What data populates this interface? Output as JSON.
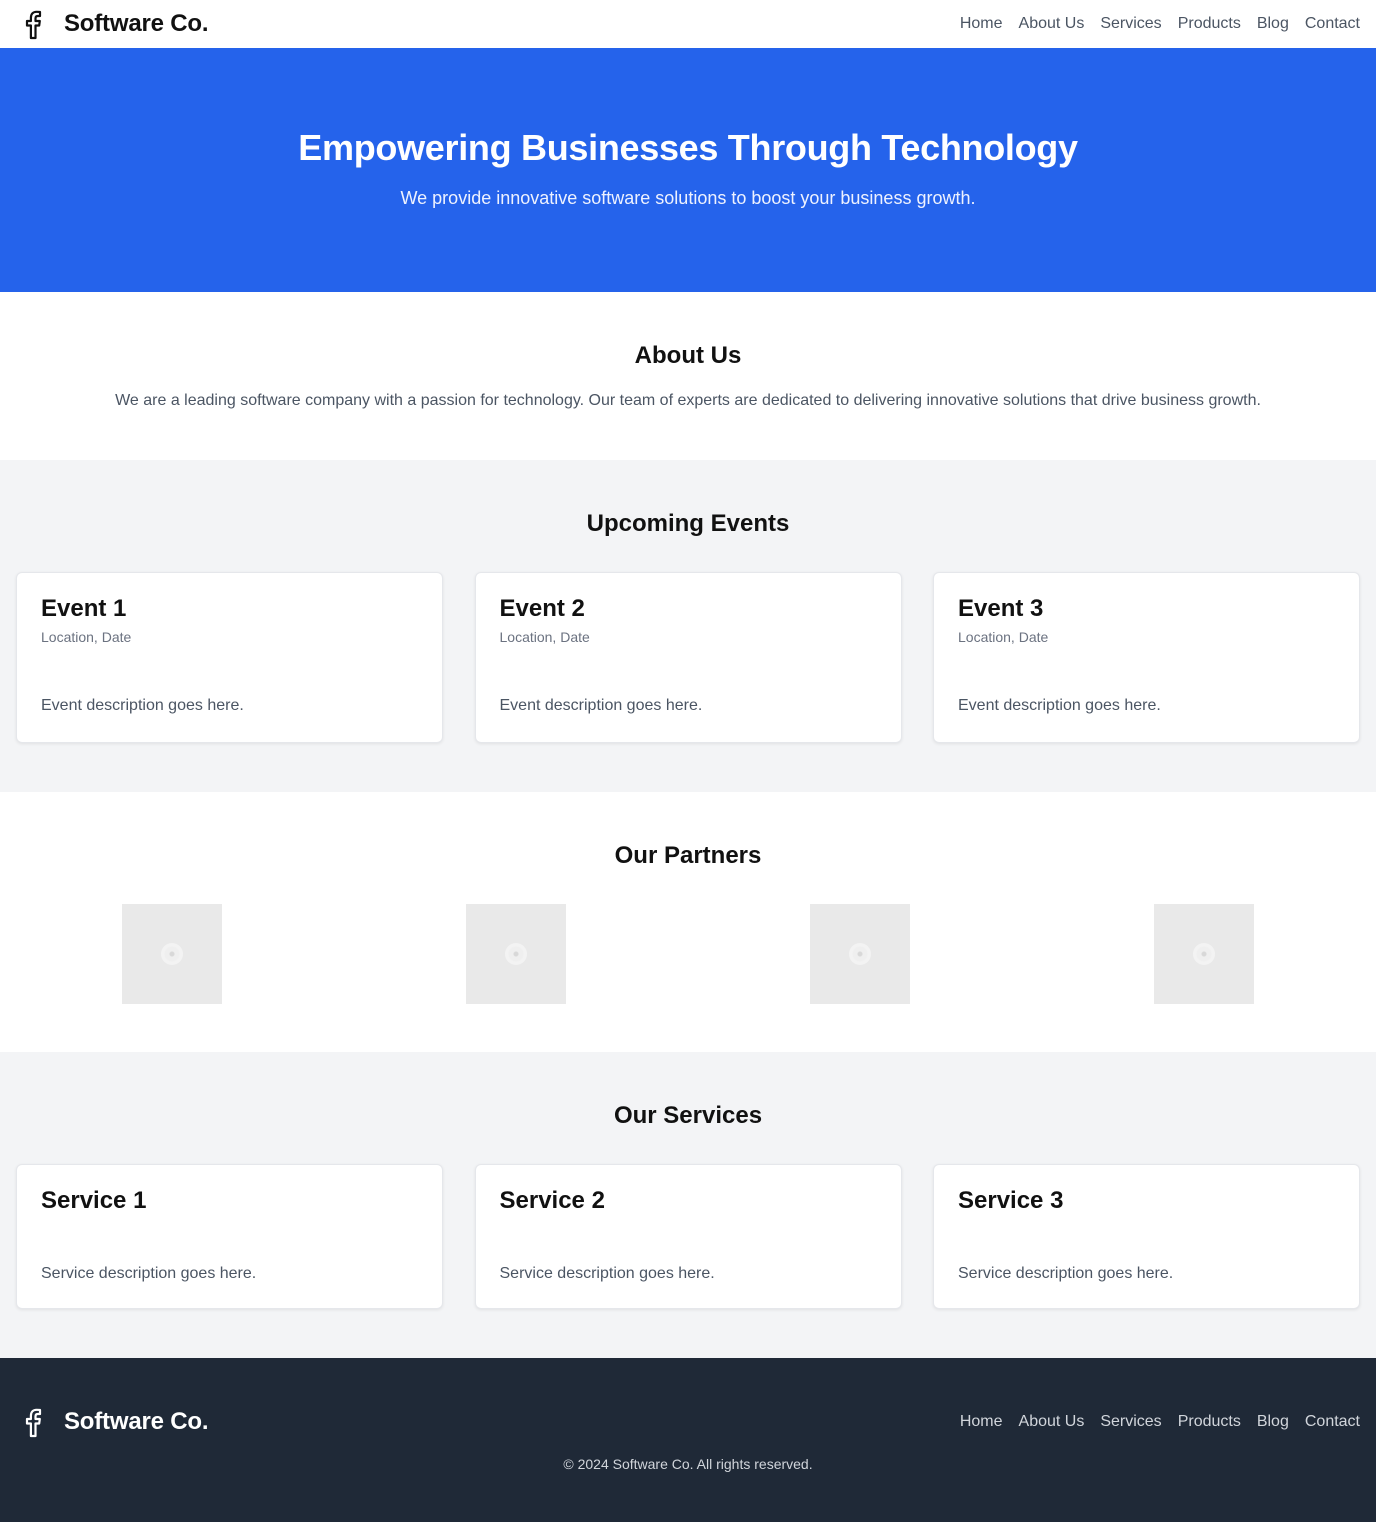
{
  "header": {
    "brand_name": "Software Co.",
    "brand_icon": "facebook-icon",
    "nav": [
      "Home",
      "About Us",
      "Services",
      "Products",
      "Blog",
      "Contact"
    ]
  },
  "hero": {
    "title": "Empowering Businesses Through Technology",
    "subtitle": "We provide innovative software solutions to boost your business growth."
  },
  "about": {
    "title": "About Us",
    "text": "We are a leading software company with a passion for technology. Our team of experts are dedicated to delivering innovative solutions that drive business growth."
  },
  "events": {
    "title": "Upcoming Events",
    "items": [
      {
        "title": "Event 1",
        "meta": "Location, Date",
        "desc": "Event description goes here."
      },
      {
        "title": "Event 2",
        "meta": "Location, Date",
        "desc": "Event description goes here."
      },
      {
        "title": "Event 3",
        "meta": "Location, Date",
        "desc": "Event description goes here."
      }
    ]
  },
  "partners": {
    "title": "Our Partners",
    "logo_icon": "image-placeholder-icon",
    "logo_count": 4
  },
  "services": {
    "title": "Our Services",
    "items": [
      {
        "title": "Service 1",
        "desc": "Service description goes here."
      },
      {
        "title": "Service 2",
        "desc": "Service description goes here."
      },
      {
        "title": "Service 3",
        "desc": "Service description goes here."
      }
    ]
  },
  "footer": {
    "brand_name": "Software Co.",
    "brand_icon": "facebook-icon",
    "nav": [
      "Home",
      "About Us",
      "Services",
      "Products",
      "Blog",
      "Contact"
    ],
    "copyright": "© 2024 Software Co. All rights reserved."
  },
  "colors": {
    "primary": "#2563eb",
    "section_alt_bg": "#f3f4f6",
    "footer_bg": "#1f2937",
    "text_muted": "#4b5563"
  }
}
